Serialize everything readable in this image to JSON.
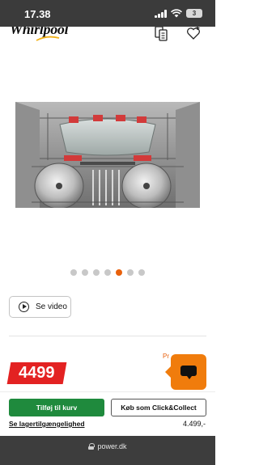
{
  "status_bar": {
    "time": "17.38",
    "battery": "3"
  },
  "header": {
    "logo_text": "Whirlpool",
    "compare_icon": "compare-icon",
    "wishlist_icon": "heart-plus-icon"
  },
  "gallery": {
    "image_alt": "Dishwasher interior",
    "dot_count": 7,
    "active_index": 4
  },
  "video_button": {
    "label": "Se video",
    "icon": "play-circle-icon"
  },
  "price_area": {
    "promo_text": "Pr",
    "price": "4499",
    "badge_color": "#e32222"
  },
  "chat": {
    "icon": "chat-icon",
    "color": "#f07c0c"
  },
  "actions": {
    "add_to_cart": "Tilføj til kurv",
    "click_collect": "Køb som Click&Collect",
    "stock_link": "Se lagertilgængelighed",
    "small_price": "4.499,-",
    "cart_color": "#1f8a3d"
  },
  "browser": {
    "url": "power.dk"
  }
}
